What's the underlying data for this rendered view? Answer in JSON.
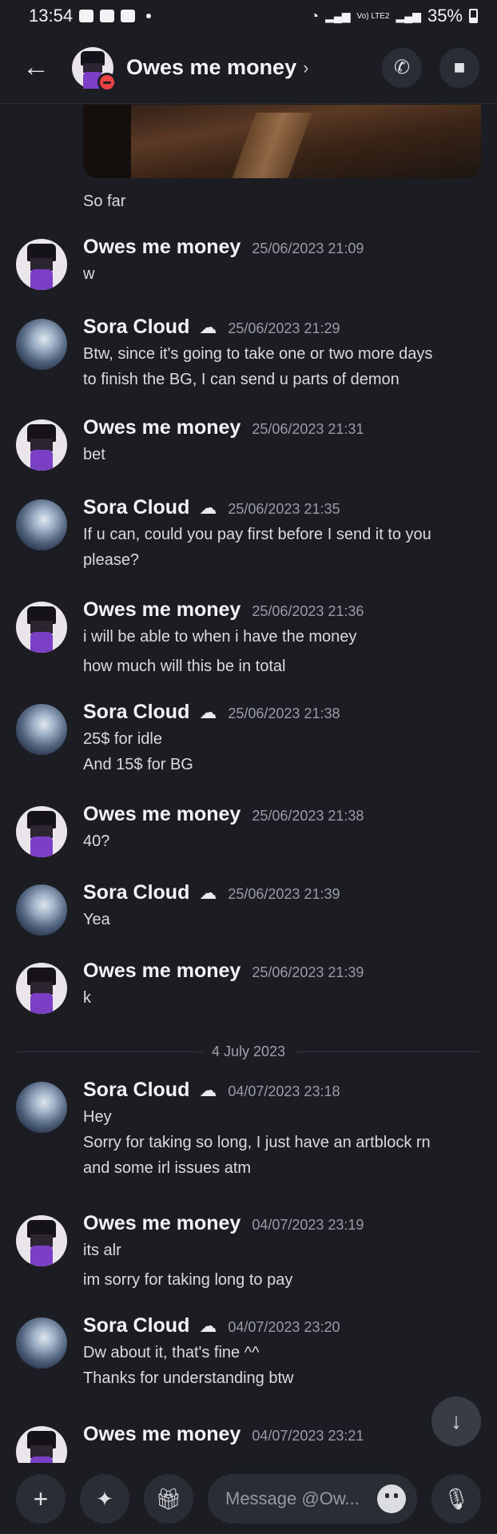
{
  "status_bar": {
    "time": "13:54",
    "network": "Vo) LTE2",
    "battery": "35%"
  },
  "header": {
    "title": "Owes me money",
    "chevron": "›"
  },
  "preview_caption": "So far",
  "messages": [
    {
      "author": "Owes me money",
      "avatar": "owes",
      "time": "25/06/2023 21:09",
      "lines": [
        "w"
      ]
    },
    {
      "author": "Sora Cloud",
      "avatar": "sora",
      "emoji": "☁",
      "time": "25/06/2023 21:29",
      "lines": [
        "Btw, since it's going to take one or two more days",
        "to finish the BG, I can send u parts of demon"
      ]
    },
    {
      "author": "Owes me money",
      "avatar": "owes",
      "time": "25/06/2023 21:31",
      "lines": [
        "bet"
      ]
    },
    {
      "author": "Sora Cloud",
      "avatar": "sora",
      "emoji": "☁",
      "time": "25/06/2023 21:35",
      "lines": [
        "If u can, could you pay first before I send it to you",
        "please?"
      ]
    },
    {
      "author": "Owes me money",
      "avatar": "owes",
      "time": "25/06/2023 21:36",
      "lines": [
        "i will be able to when i have the money",
        "how much will this be in total"
      ]
    },
    {
      "author": "Sora Cloud",
      "avatar": "sora",
      "emoji": "☁",
      "time": "25/06/2023 21:38",
      "lines": [
        "25$ for idle",
        "And 15$ for BG"
      ]
    },
    {
      "author": "Owes me money",
      "avatar": "owes",
      "time": "25/06/2023 21:38",
      "lines": [
        "40?"
      ]
    },
    {
      "author": "Sora Cloud",
      "avatar": "sora",
      "emoji": "☁",
      "time": "25/06/2023 21:39",
      "lines": [
        "Yea"
      ]
    },
    {
      "author": "Owes me money",
      "avatar": "owes",
      "time": "25/06/2023 21:39",
      "lines": [
        "k"
      ]
    },
    {
      "author": "Sora Cloud",
      "avatar": "sora",
      "emoji": "☁",
      "time": "04/07/2023 23:18",
      "lines": [
        "Hey",
        "Sorry for taking so long, I just have an artblock rn",
        "and some irl issues atm"
      ]
    },
    {
      "author": "Owes me money",
      "avatar": "owes",
      "time": "04/07/2023 23:19",
      "lines": [
        "its alr",
        "im sorry for taking long to pay"
      ]
    },
    {
      "author": "Sora Cloud",
      "avatar": "sora",
      "emoji": "☁",
      "time": "04/07/2023 23:20",
      "lines": [
        "Dw about it, that's fine ^^",
        "Thanks for understanding btw"
      ]
    },
    {
      "author": "Owes me money",
      "avatar": "owes",
      "time": "04/07/2023 23:21",
      "lines": []
    }
  ],
  "date_divider": "4 July 2023",
  "composer": {
    "placeholder": "Message @Ow..."
  }
}
